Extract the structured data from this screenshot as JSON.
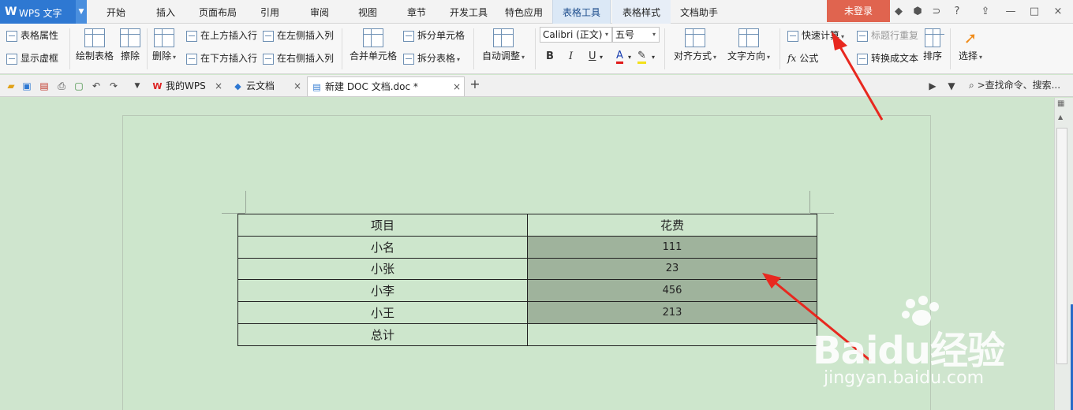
{
  "app": {
    "logo": "W",
    "title": "WPS 文字",
    "menu_tabs": [
      "开始",
      "插入",
      "页面布局",
      "引用",
      "审阅",
      "视图",
      "章节",
      "开发工具",
      "特色应用",
      "表格工具",
      "表格样式",
      "文档助手"
    ],
    "login_label": "未登录",
    "window_controls": [
      "?",
      "—",
      "□",
      "×"
    ]
  },
  "ribbon": {
    "table_props": "表格属性",
    "show_gridlines": "显示虚框",
    "draw_table": "绘制表格",
    "erase": "擦除",
    "delete": "删除",
    "insert_row_above": "在上方插入行",
    "insert_row_below": "在下方插入行",
    "insert_col_left": "在左侧插入列",
    "insert_col_right": "在右侧插入列",
    "merge_cells": "合并单元格",
    "split_cells": "拆分单元格",
    "split_table": "拆分表格",
    "auto_fit": "自动调整",
    "font_name": "Calibri (正文)",
    "font_size": "五号",
    "bold": "B",
    "italic": "I",
    "underline": "U",
    "font_color": "A",
    "align": "对齐方式",
    "text_direction": "文字方向",
    "quick_calc": "快速计算",
    "header_repeat": "标题行重复",
    "formula_icon": "fx",
    "formula": "公式",
    "to_text": "转换成文本",
    "sort": "排序",
    "select": "选择"
  },
  "tabs": [
    {
      "label": "我的WPS",
      "icon": "wps-icon"
    },
    {
      "label": "云文档",
      "icon": "cloud-icon"
    },
    {
      "label": "新建 DOC 文档.doc *",
      "icon": "doc-icon"
    }
  ],
  "search_cmd": ">查找命令、搜索...",
  "table": {
    "headers": [
      "项目",
      "花费"
    ],
    "rows": [
      [
        "小名",
        "111"
      ],
      [
        "小张",
        "23"
      ],
      [
        "小李",
        "456"
      ],
      [
        "小王",
        "213"
      ],
      [
        "总计",
        ""
      ]
    ]
  },
  "watermark": {
    "brand": "Baidu经验",
    "domain": "jingyan.baidu.com"
  },
  "colors": {
    "accent": "#2e78d2",
    "login": "#e0644f",
    "page_bg": "#cde6cc",
    "selection": "#9fb39c",
    "arrow": "#e8281f"
  }
}
